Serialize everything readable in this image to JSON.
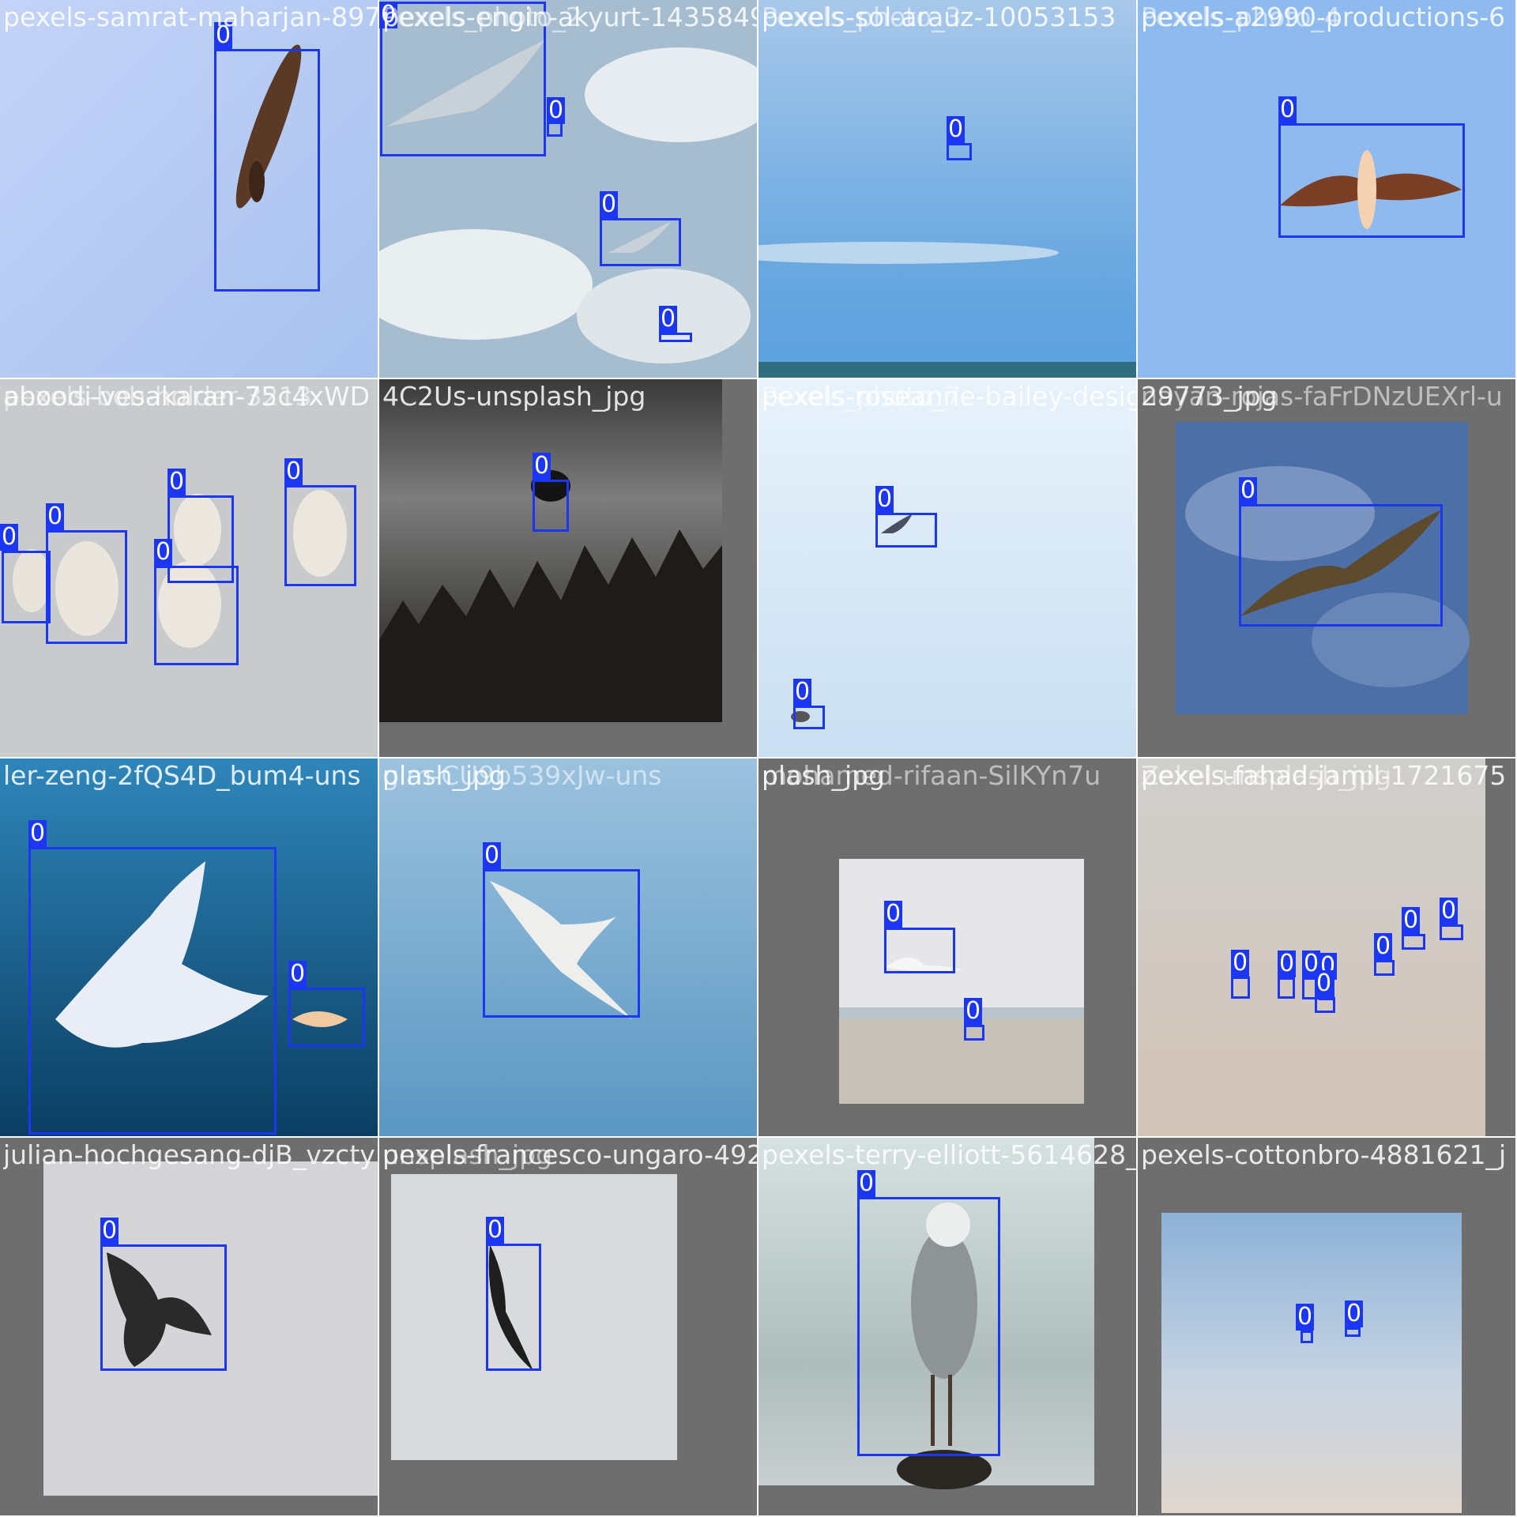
{
  "mosaic": {
    "tiles": [
      {
        "titles": [
          "pexels-samrat-maharjan-897"
        ],
        "label": "0"
      },
      {
        "titles": [
          "pexels-engin-akyurt-1435849",
          "Pexels_photo_2"
        ],
        "label": "0"
      },
      {
        "titles": [
          "pexels-sol-arauz-10053153",
          "Pexels_photo_3"
        ],
        "label": "0"
      },
      {
        "titles": [
          "pexels-a2990-productions-6",
          "Pexels_photo_4"
        ],
        "label": "0"
      },
      {
        "titles": [
          "aboodi-vesakaran-75c4xWD",
          "pexels-bob-holder-3213"
        ],
        "label": "0"
      },
      {
        "titles": [
          "4C2Us-unsplash_jpg"
        ],
        "label": "0"
      },
      {
        "titles": [
          "pexels-roseanne-bailey-designs-9",
          "Pexels_photo_7"
        ],
        "label": "0"
      },
      {
        "titles": [
          "29773_jpg",
          "nayan-rojas-faFrDNzUEXrl-u"
        ],
        "label": "0"
      },
      {
        "titles": [
          "ler-zeng-2fQS4D_bum4-uns"
        ],
        "label": "0"
      },
      {
        "titles": [
          "plash_jpg",
          "gim-CU9b539xJw-uns"
        ],
        "label": "0"
      },
      {
        "titles": [
          "plash_jpg",
          "mohamed-rifaan-SilKYn7u"
        ],
        "label": "0"
      },
      {
        "titles": [
          "pexels-fahad-jamil-1721675",
          "Zekel-unsplash_jpg"
        ],
        "label": "0"
      },
      {
        "titles": [
          "julian-hochgesang-djB_vzcty"
        ],
        "label": "0"
      },
      {
        "titles": [
          "pexels-francesco-ungaro-492419",
          "unsplash_jpg"
        ],
        "label": "0"
      },
      {
        "titles": [
          "pexels-terry-elliott-5614628_jpg"
        ],
        "label": "0"
      },
      {
        "titles": [
          "pexels-cottonbro-4881621_j"
        ],
        "label": "0"
      }
    ]
  },
  "colors": {
    "box": "#1b36f5",
    "label_text": "#ffffff",
    "pad_gray": "#6e6e6e"
  }
}
